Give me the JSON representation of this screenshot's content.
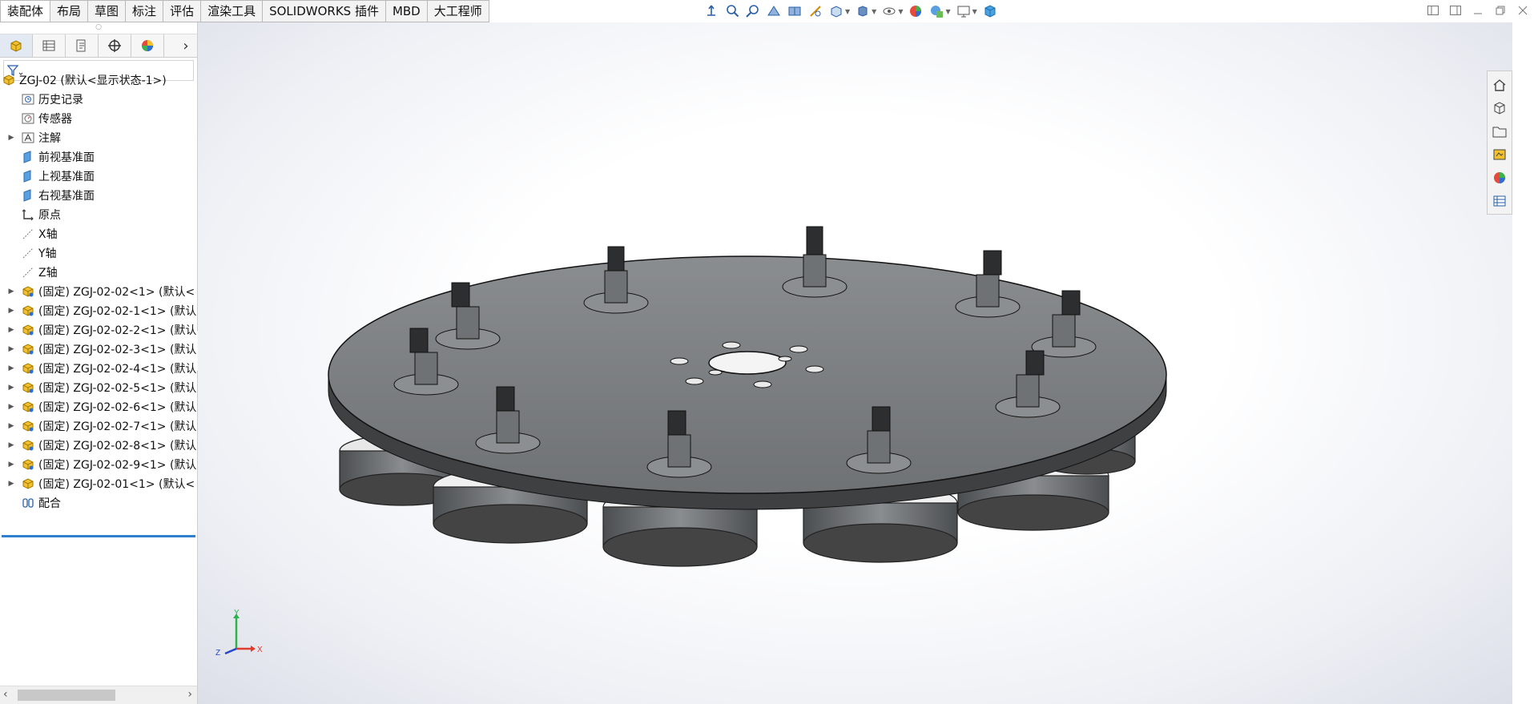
{
  "tabs": [
    "装配体",
    "布局",
    "草图",
    "标注",
    "评估",
    "渲染工具",
    "SOLIDWORKS 插件",
    "MBD",
    "大工程师"
  ],
  "panel": {
    "grip": "○",
    "tabs_more": "›",
    "tree": [
      {
        "label": "ZGJ-02  (默认<显示状态-1>)",
        "icon": "assembly-icon",
        "expand": ""
      },
      {
        "label": "历史记录",
        "icon": "history-icon",
        "expand": ""
      },
      {
        "label": "传感器",
        "icon": "sensor-icon",
        "expand": ""
      },
      {
        "label": "注解",
        "icon": "annotation-icon",
        "expand": "▶"
      },
      {
        "label": "前视基准面",
        "icon": "plane-icon",
        "expand": ""
      },
      {
        "label": "上视基准面",
        "icon": "plane-icon",
        "expand": ""
      },
      {
        "label": "右视基准面",
        "icon": "plane-icon",
        "expand": ""
      },
      {
        "label": "原点",
        "icon": "origin-icon",
        "expand": ""
      },
      {
        "label": "X轴",
        "icon": "axis-icon",
        "expand": ""
      },
      {
        "label": "Y轴",
        "icon": "axis-icon",
        "expand": ""
      },
      {
        "label": "Z轴",
        "icon": "axis-icon",
        "expand": ""
      },
      {
        "label": "(固定) ZGJ-02-02<1> (默认<",
        "icon": "subassembly-icon",
        "expand": "▶"
      },
      {
        "label": "(固定) ZGJ-02-02-1<1> (默认",
        "icon": "subassembly-icon",
        "expand": "▶"
      },
      {
        "label": "(固定) ZGJ-02-02-2<1> (默认",
        "icon": "subassembly-icon",
        "expand": "▶"
      },
      {
        "label": "(固定) ZGJ-02-02-3<1> (默认",
        "icon": "subassembly-icon",
        "expand": "▶"
      },
      {
        "label": "(固定) ZGJ-02-02-4<1> (默认",
        "icon": "subassembly-icon",
        "expand": "▶"
      },
      {
        "label": "(固定) ZGJ-02-02-5<1> (默认",
        "icon": "subassembly-icon",
        "expand": "▶"
      },
      {
        "label": "(固定) ZGJ-02-02-6<1> (默认",
        "icon": "subassembly-icon",
        "expand": "▶"
      },
      {
        "label": "(固定) ZGJ-02-02-7<1> (默认",
        "icon": "subassembly-icon",
        "expand": "▶"
      },
      {
        "label": "(固定) ZGJ-02-02-8<1> (默认",
        "icon": "subassembly-icon",
        "expand": "▶"
      },
      {
        "label": "(固定) ZGJ-02-02-9<1> (默认",
        "icon": "subassembly-icon",
        "expand": "▶"
      },
      {
        "label": "(固定) ZGJ-02-01<1> (默认<",
        "icon": "part-icon",
        "expand": "▶"
      },
      {
        "label": "配合",
        "icon": "mates-icon",
        "expand": ""
      }
    ],
    "scroll_left": "‹",
    "scroll_right": "›"
  },
  "triad": {
    "x": "X",
    "y": "Y",
    "z": "Z"
  },
  "colors": {
    "accent": "#2f7fd1",
    "part_gray": "#7d8082",
    "part_dark": "#3a3c3e"
  }
}
